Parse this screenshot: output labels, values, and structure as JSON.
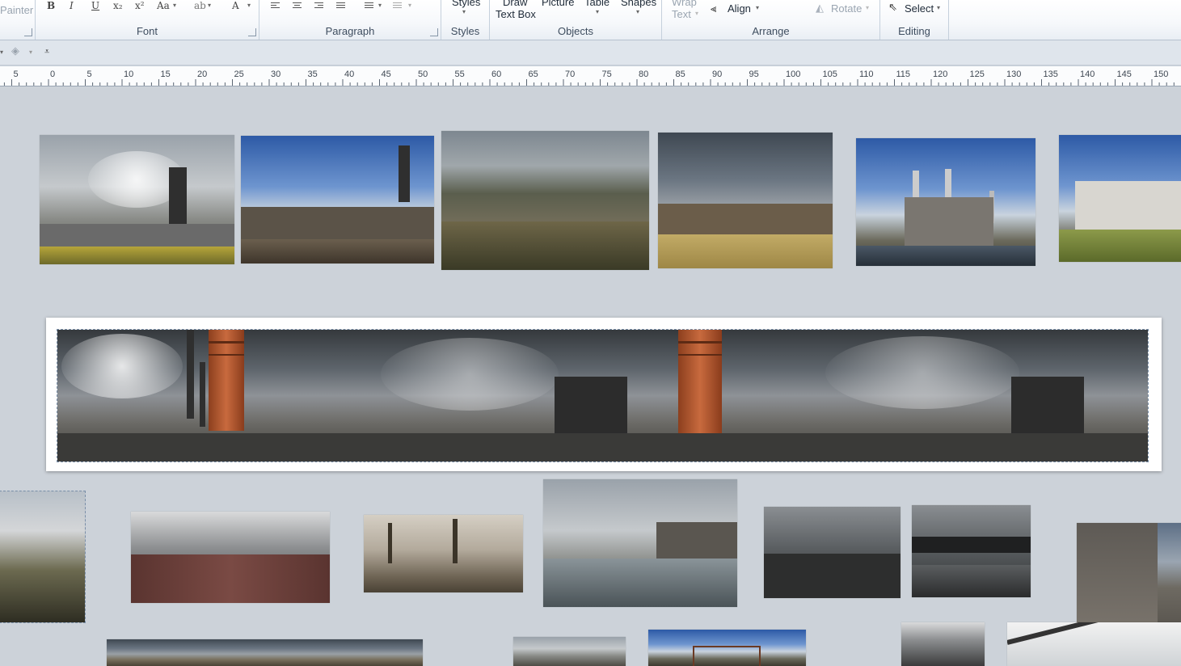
{
  "ribbon": {
    "clipboard_partial": "Painter",
    "groups": {
      "font": "Font",
      "paragraph": "Paragraph",
      "styles": "Styles",
      "objects": "Objects",
      "arrange": "Arrange",
      "editing": "Editing"
    },
    "font_buttons": [
      "B",
      "I",
      "U",
      "x₂",
      "x²",
      "Aa",
      "A"
    ],
    "styles_button": "Styles",
    "objects": {
      "draw_text_box_line1": "Draw",
      "draw_text_box_line2": "Text Box",
      "picture": "Picture",
      "table": "Table",
      "shapes": "Shapes"
    },
    "arrange": {
      "wrap_text_line1": "Wrap",
      "wrap_text_line2": "Text",
      "align": "Align",
      "rotate": "Rotate"
    },
    "editing": {
      "select": "Select"
    }
  },
  "ruler": {
    "labels": [
      "5",
      "0",
      "5",
      "10",
      "15",
      "20",
      "25",
      "30",
      "35",
      "40",
      "45",
      "50",
      "55",
      "60",
      "65",
      "70",
      "75",
      "80",
      "85",
      "90",
      "95",
      "100",
      "105",
      "110",
      "115",
      "120",
      "125",
      "130",
      "135",
      "140",
      "145",
      "150"
    ]
  },
  "colors": {
    "canvas": "#ccd2d9",
    "ribbon_text": "#3e4d5f",
    "selection_outline": "#7a8fa8"
  },
  "images": [
    {
      "name": "steelworks-smoke-photo"
    },
    {
      "name": "colliery-headframe-photo"
    },
    {
      "name": "mountain-industrial-town-photo"
    },
    {
      "name": "stormy-factory-field-photo"
    },
    {
      "name": "battersea-power-station-photo"
    },
    {
      "name": "farmhouse-blue-sky-photo"
    },
    {
      "name": "industrial-panorama-banner"
    },
    {
      "name": "smoky-hillside-photo"
    },
    {
      "name": "terraced-houses-photo"
    },
    {
      "name": "sepia-chimneys-town-photo"
    },
    {
      "name": "derelict-shed-canal-photo"
    },
    {
      "name": "victorian-mill-town-photo"
    },
    {
      "name": "viaduct-river-photo"
    },
    {
      "name": "brick-mill-building-photo"
    },
    {
      "name": "mirrored-landscape-photo"
    },
    {
      "name": "cloudy-factory-photo"
    },
    {
      "name": "gasholder-photo"
    },
    {
      "name": "steel-frame-photo"
    },
    {
      "name": "conveyor-bridge-photo"
    }
  ]
}
